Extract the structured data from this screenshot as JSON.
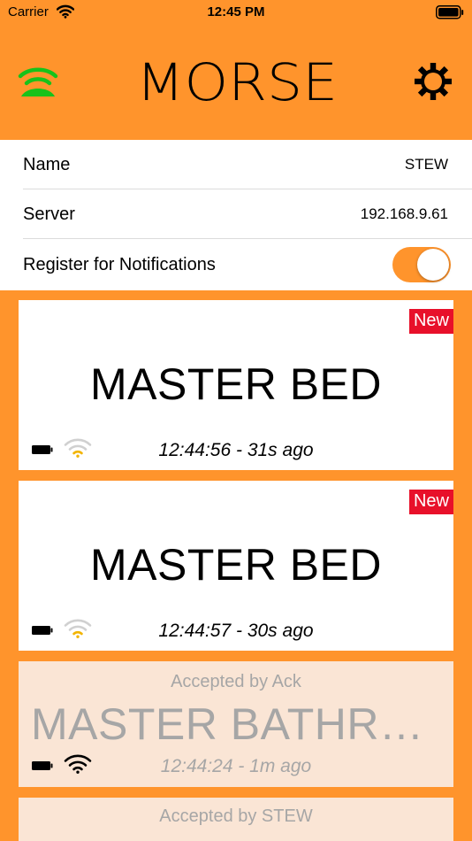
{
  "status_bar": {
    "carrier": "Carrier",
    "time": "12:45 PM"
  },
  "header": {
    "logo_text": "MORSE",
    "signal_icon": "broadcast-signal-icon",
    "settings_icon": "gear-icon"
  },
  "colors": {
    "accent": "#FF942C",
    "badge_red": "#E8102A",
    "signal_green": "#18C21A",
    "wifi_yellow": "#F2B400",
    "accepted_bg": "#FAE5D5",
    "muted_text": "#A6A6A6"
  },
  "settings": {
    "name_label": "Name",
    "name_value": "STEW",
    "server_label": "Server",
    "server_value": "192.168.9.61",
    "notifications_label": "Register for Notifications",
    "notifications_enabled": true
  },
  "alerts": [
    {
      "badge": "New",
      "title": "MASTER BED",
      "time": "12:44:56 - 31s ago",
      "wifi_strength": "weak"
    },
    {
      "badge": "New",
      "title": "MASTER BED",
      "time": "12:44:57 - 30s ago",
      "wifi_strength": "weak"
    },
    {
      "accepted_by": "Accepted by Ack",
      "title": "MASTER BATHROOM",
      "time": "12:44:24 - 1m ago",
      "wifi_strength": "strong"
    },
    {
      "accepted_by": "Accepted by STEW"
    }
  ]
}
